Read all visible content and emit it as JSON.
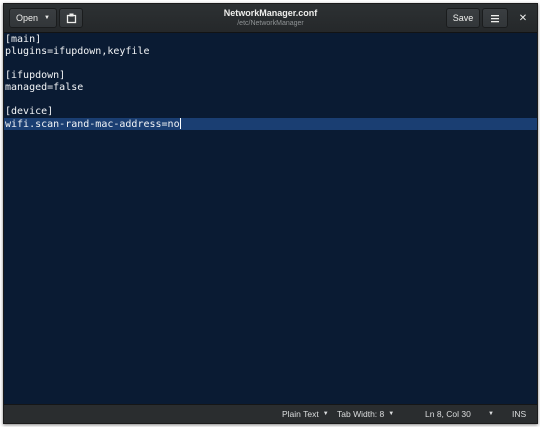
{
  "header": {
    "open_label": "Open",
    "title": "NetworkManager.conf",
    "subtitle": "/etc/NetworkManager",
    "save_label": "Save"
  },
  "editor": {
    "lines": [
      "[main]",
      "plugins=ifupdown,keyfile",
      "",
      "[ifupdown]",
      "managed=false",
      "",
      "[device]",
      "wifi.scan-rand-mac-address=no"
    ],
    "current_line": 7
  },
  "statusbar": {
    "language": "Plain Text",
    "tab_width": "Tab Width: 8",
    "cursor_position": "Ln 8, Col 30",
    "insert_mode": "INS"
  },
  "colors": {
    "editor_background": "#0a1b33",
    "current_line_highlight": "#1a3e72",
    "headerbar": "#2d3133",
    "text": "#f3f5f7"
  },
  "icons": {
    "open_dropdown": "chevron-down-icon",
    "new_document": "new-document-icon",
    "menu": "hamburger-menu-icon",
    "close": "close-icon"
  }
}
